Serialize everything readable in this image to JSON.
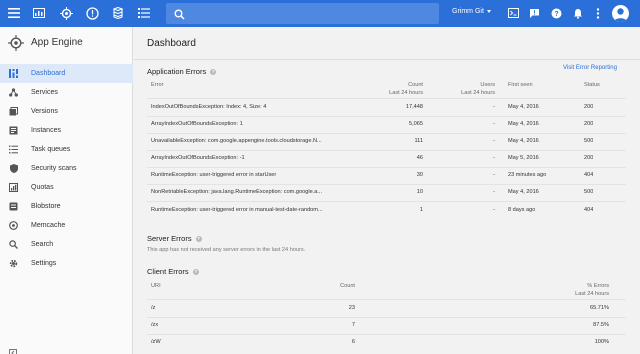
{
  "topbar": {
    "icons": [
      "menu-icon",
      "dashboard-icon",
      "app-engine-icon",
      "alert-icon",
      "storage-icon",
      "list-icon",
      "search-icon"
    ],
    "project": "Grimm Git",
    "right_icons": [
      "console-icon",
      "feedback-icon",
      "help-icon",
      "notifications-icon",
      "more-icon",
      "account-icon"
    ],
    "accent": "#2b6fd8"
  },
  "sidebar": {
    "app_title": "App Engine",
    "items": [
      {
        "label": "Dashboard",
        "icon": "dashboard-icon",
        "active": true
      },
      {
        "label": "Services",
        "icon": "services-icon"
      },
      {
        "label": "Versions",
        "icon": "versions-icon"
      },
      {
        "label": "Instances",
        "icon": "instances-icon"
      },
      {
        "label": "Task queues",
        "icon": "task-queues-icon"
      },
      {
        "label": "Security scans",
        "icon": "security-icon"
      },
      {
        "label": "Quotas",
        "icon": "quotas-icon"
      },
      {
        "label": "Blobstore",
        "icon": "blobstore-icon"
      },
      {
        "label": "Memcache",
        "icon": "memcache-icon"
      },
      {
        "label": "Search",
        "icon": "search-icon"
      },
      {
        "label": "Settings",
        "icon": "settings-icon"
      }
    ]
  },
  "main": {
    "title": "Dashboard",
    "app_errors": {
      "title": "Application Errors",
      "link": "Visit Error Reporting",
      "headers": {
        "error": "Error",
        "count_1": "Count",
        "count_2": "Last 24 hours",
        "users_1": "Users",
        "users_2": "Last 24 hours",
        "first_seen": "First seen",
        "status": "Status"
      },
      "rows": [
        {
          "error": "IndexOutOfBoundsException: Index: 4, Size: 4",
          "count": "17,448",
          "users": "-",
          "first_seen": "May 4, 2016",
          "status": "200"
        },
        {
          "error": "ArrayIndexOutOfBoundsException: 1",
          "count": "5,065",
          "users": "-",
          "first_seen": "May 4, 2016",
          "status": "200"
        },
        {
          "error": "UnavailableException: com.google.appengine.tools.cloudstorage.N...",
          "count": "111",
          "users": "-",
          "first_seen": "May 4, 2016",
          "status": "500"
        },
        {
          "error": "ArrayIndexOutOfBoundsException: -1",
          "count": "46",
          "users": "-",
          "first_seen": "May 5, 2016",
          "status": "200"
        },
        {
          "error": "RuntimeException: user-triggered error in starUser",
          "count": "30",
          "users": "-",
          "first_seen": "23 minutes ago",
          "status": "404"
        },
        {
          "error": "NonRetriableException: java.lang.RuntimeException: com.google.a...",
          "count": "10",
          "users": "-",
          "first_seen": "May 4, 2016",
          "status": "500"
        },
        {
          "error": "RuntimeException: user-triggered error in manual-test-date-random...",
          "count": "1",
          "users": "-",
          "first_seen": "8 days ago",
          "status": "404"
        }
      ]
    },
    "server_errors": {
      "title": "Server Errors",
      "note": "This app has not received any server errors in the last 24 hours."
    },
    "client_errors": {
      "title": "Client Errors",
      "headers": {
        "uri": "URI",
        "count": "Count",
        "pct_1": "% Errors",
        "pct_2": "Last 24 hours"
      },
      "rows": [
        {
          "uri": "/z",
          "count": "23",
          "pct": "65.71%"
        },
        {
          "uri": "/zx",
          "count": "7",
          "pct": "87.5%"
        },
        {
          "uri": "/zW",
          "count": "6",
          "pct": "100%"
        }
      ]
    }
  }
}
